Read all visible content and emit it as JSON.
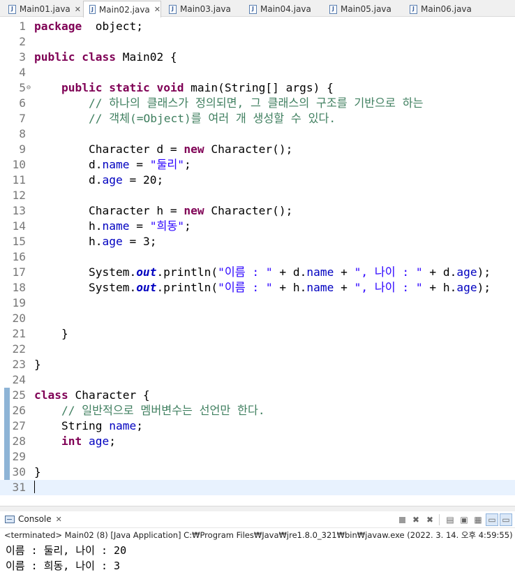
{
  "tabs": [
    {
      "name": "Main01.java",
      "active": false,
      "closable": true
    },
    {
      "name": "Main02.java",
      "active": true,
      "closable": true
    },
    {
      "name": "Main03.java",
      "active": false,
      "closable": false
    },
    {
      "name": "Main04.java",
      "active": false,
      "closable": false
    },
    {
      "name": "Main05.java",
      "active": false,
      "closable": false
    },
    {
      "name": "Main06.java",
      "active": false,
      "closable": false
    }
  ],
  "editor": {
    "lines": [
      [
        [
          "kw",
          "package"
        ],
        [
          "",
          "  object;"
        ]
      ],
      [],
      [
        [
          "kw",
          "public"
        ],
        [
          "",
          " "
        ],
        [
          "kw",
          "class"
        ],
        [
          "",
          " Main02 {"
        ]
      ],
      [],
      [
        [
          "",
          "    "
        ],
        [
          "kw",
          "public"
        ],
        [
          "",
          " "
        ],
        [
          "kw",
          "static"
        ],
        [
          "",
          " "
        ],
        [
          "kw",
          "void"
        ],
        [
          "",
          " main(String[] args) {"
        ]
      ],
      [
        [
          "",
          "        "
        ],
        [
          "cm",
          "// 하나의 클래스가 정의되면, 그 클래스의 구조를 기반으로 하는"
        ]
      ],
      [
        [
          "",
          "        "
        ],
        [
          "cm",
          "// 객체(=Object)를 여러 개 생성할 수 있다."
        ]
      ],
      [],
      [
        [
          "",
          "        Character d = "
        ],
        [
          "kw",
          "new"
        ],
        [
          "",
          " Character();"
        ]
      ],
      [
        [
          "",
          "        d."
        ],
        [
          "fld",
          "name"
        ],
        [
          "",
          " = "
        ],
        [
          "str",
          "\"둘리\""
        ],
        [
          "",
          ";"
        ]
      ],
      [
        [
          "",
          "        d."
        ],
        [
          "fld",
          "age"
        ],
        [
          "",
          " = 20;"
        ]
      ],
      [],
      [
        [
          "",
          "        Character h = "
        ],
        [
          "kw",
          "new"
        ],
        [
          "",
          " Character();"
        ]
      ],
      [
        [
          "",
          "        h."
        ],
        [
          "fld",
          "name"
        ],
        [
          "",
          " = "
        ],
        [
          "str",
          "\"희동\""
        ],
        [
          "",
          ";"
        ]
      ],
      [
        [
          "",
          "        h."
        ],
        [
          "fld",
          "age"
        ],
        [
          "",
          " = 3;"
        ]
      ],
      [],
      [
        [
          "",
          "        System."
        ],
        [
          "stat",
          "out"
        ],
        [
          "",
          ".println("
        ],
        [
          "str",
          "\"이름 : \""
        ],
        [
          "",
          " + d."
        ],
        [
          "fld",
          "name"
        ],
        [
          "",
          " + "
        ],
        [
          "str",
          "\", 나이 : \""
        ],
        [
          "",
          " + d."
        ],
        [
          "fld",
          "age"
        ],
        [
          "",
          ");"
        ]
      ],
      [
        [
          "",
          "        System."
        ],
        [
          "stat",
          "out"
        ],
        [
          "",
          ".println("
        ],
        [
          "str",
          "\"이름 : \""
        ],
        [
          "",
          " + h."
        ],
        [
          "fld",
          "name"
        ],
        [
          "",
          " + "
        ],
        [
          "str",
          "\", 나이 : \""
        ],
        [
          "",
          " + h."
        ],
        [
          "fld",
          "age"
        ],
        [
          "",
          ");"
        ]
      ],
      [],
      [],
      [
        [
          "",
          "    }"
        ]
      ],
      [],
      [
        [
          "",
          "}"
        ]
      ],
      [],
      [
        [
          "kw",
          "class"
        ],
        [
          "",
          " Character {"
        ]
      ],
      [
        [
          "",
          "    "
        ],
        [
          "cm",
          "// 일반적으로 멤버변수는 선언만 한다."
        ]
      ],
      [
        [
          "",
          "    String "
        ],
        [
          "fld",
          "name"
        ],
        [
          "",
          ";"
        ]
      ],
      [
        [
          "",
          "    "
        ],
        [
          "kw",
          "int"
        ],
        [
          "",
          " "
        ],
        [
          "fld",
          "age"
        ],
        [
          "",
          ";"
        ]
      ],
      [],
      [
        [
          "",
          "}"
        ]
      ],
      []
    ],
    "current_line": 31,
    "fold_marker_line": 5,
    "changed_lines_from": 25,
    "changed_lines_to": 30
  },
  "console": {
    "tab_label": "Console",
    "status": "<terminated> Main02 (8) [Java Application] C:₩Program Files₩Java₩jre1.8.0_321₩bin₩javaw.exe (2022. 3. 14. 오후 4:59:55)",
    "output": [
      "이름 : 둘리, 나이 : 20",
      "이름 : 희동, 나이 : 3"
    ]
  }
}
